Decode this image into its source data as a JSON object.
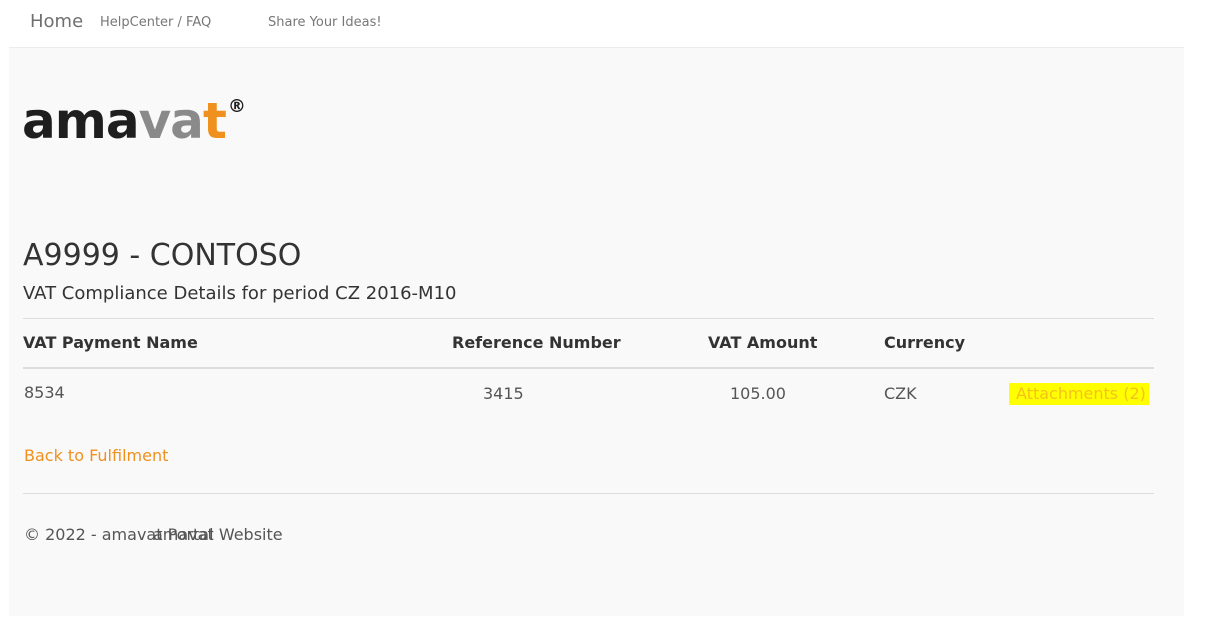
{
  "nav": {
    "home": "Home",
    "helpcenter": "HelpCenter / FAQ",
    "ideas": "Share Your Ideas!"
  },
  "logo": {
    "part1": "ama",
    "part2": "va",
    "part3": "t",
    "registered": "®",
    "colors": {
      "dark": "#1e1e1e",
      "grey": "#8a8a8a",
      "accent": "#f0901e"
    }
  },
  "client": {
    "title": "A9999 - CONTOSO",
    "subtitle": "VAT Compliance Details for period CZ 2016-M10"
  },
  "table": {
    "headers": [
      "VAT Payment Name",
      "Reference Number",
      "VAT Amount",
      "Currency"
    ],
    "rows": [
      {
        "payment_name": "8534",
        "reference_number": "3415",
        "vat_amount": "105.00",
        "currency": "CZK",
        "attachments_label": "Attachments (2)"
      }
    ]
  },
  "links": {
    "back": "Back to Fulfilment"
  },
  "footer": {
    "copyright": "© 2022 - amavat Portal",
    "website": "amavat Website"
  },
  "colors": {
    "link": "#f0901e",
    "highlight": "#ffff00",
    "background": "#f9f9f9"
  }
}
